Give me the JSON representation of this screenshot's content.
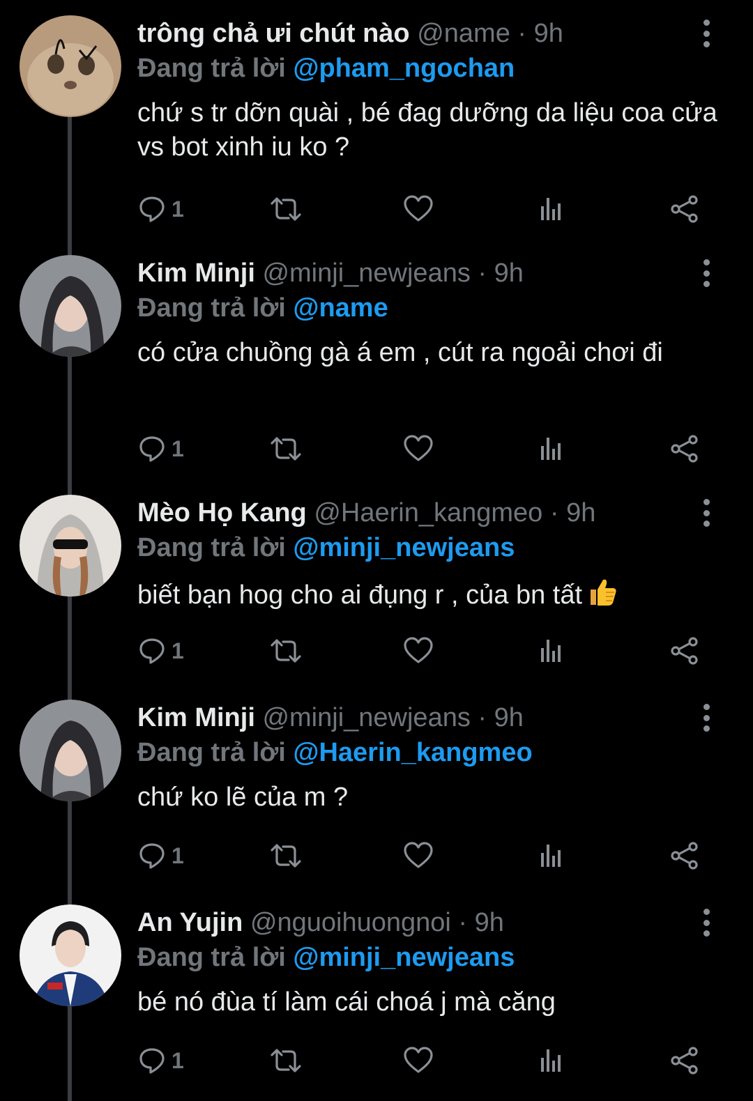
{
  "colors": {
    "background": "#000000",
    "text": "#e7e9ea",
    "muted": "#71767b",
    "mention": "#1d9bf0",
    "thread_line": "#3a3d41"
  },
  "tweets": [
    {
      "display_name": "trông chả ưi chút nào",
      "handle": "@name",
      "time": "· 9h",
      "reply_prefix": "Đang trả lời",
      "reply_to": "@pham_ngochan",
      "text": "chứ s tr dỡn quài , bé đag dưỡng da liệu coa cửa vs bot xinh iu ko ?",
      "emoji": "",
      "reply_count": "1",
      "avatar_icon": "cat-avatar-icon"
    },
    {
      "display_name": "Kim Minji",
      "handle": "@minji_newjeans",
      "time": "· 9h",
      "reply_prefix": "Đang trả lời",
      "reply_to": "@name",
      "text": "có cửa chuồng gà á em , cút ra ngoải chơi đi",
      "emoji": "",
      "reply_count": "1",
      "avatar_icon": "profile-photo-icon"
    },
    {
      "display_name": "Mèo Họ Kang",
      "handle": "@Haerin_kangmeo",
      "time": "· 9h",
      "reply_prefix": "Đang trả lời",
      "reply_to": "@minji_newjeans",
      "text": "biết bạn hog cho ai đụng r , của bn tất",
      "emoji": "thumbs-up-icon",
      "reply_count": "1",
      "avatar_icon": "profile-photo-icon"
    },
    {
      "display_name": "Kim Minji",
      "handle": "@minji_newjeans",
      "time": "· 9h",
      "reply_prefix": "Đang trả lời",
      "reply_to": "@Haerin_kangmeo",
      "text": "chứ ko lẽ của m ?",
      "emoji": "",
      "reply_count": "1",
      "avatar_icon": "profile-photo-icon"
    },
    {
      "display_name": "An Yujin",
      "handle": "@nguoihuongnoi",
      "time": "· 9h",
      "reply_prefix": "Đang trả lời",
      "reply_to": "@minji_newjeans",
      "text": "bé nó đùa tí làm cái choá j mà căng",
      "emoji": "",
      "reply_count": "1",
      "avatar_icon": "profile-photo-icon"
    }
  ]
}
